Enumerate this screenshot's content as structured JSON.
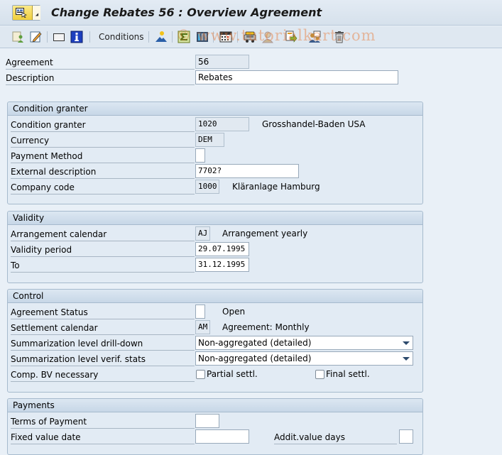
{
  "window": {
    "title": "Change Rebates 56 : Overview Agreement"
  },
  "toolbar": {
    "items": [
      {
        "name": "display-change-icon",
        "type": "icon"
      },
      {
        "name": "edit-icon",
        "type": "icon"
      },
      {
        "name": "blank-screen-icon",
        "type": "icon"
      },
      {
        "name": "info-icon",
        "type": "icon"
      },
      {
        "name": "conditions-button",
        "type": "text",
        "label": "Conditions"
      },
      {
        "name": "partner-icon",
        "type": "icon"
      },
      {
        "name": "sum-icon",
        "type": "icon"
      },
      {
        "name": "columns-icon",
        "type": "icon"
      },
      {
        "name": "calendar-icon",
        "type": "icon"
      },
      {
        "name": "vehicle-icon",
        "type": "icon"
      },
      {
        "name": "user-icon",
        "type": "icon"
      },
      {
        "name": "document-export-icon",
        "type": "icon"
      },
      {
        "name": "people-icon",
        "type": "icon"
      },
      {
        "name": "trash-icon",
        "type": "icon"
      }
    ],
    "conditions_label": "Conditions",
    "watermark": "© www.tutorialkart.com"
  },
  "header": {
    "agreement_label": "Agreement",
    "agreement_value": "56",
    "description_label": "Description",
    "description_value": "Rebates"
  },
  "condition_granter": {
    "title": "Condition granter",
    "granter_label": "Condition granter",
    "granter_value": "1020",
    "granter_name": "Grosshandel-Baden USA",
    "currency_label": "Currency",
    "currency_value": "DEM",
    "payment_method_label": "Payment Method",
    "payment_method_value": "",
    "external_desc_label": "External description",
    "external_desc_value": "7702?",
    "company_code_label": "Company code",
    "company_code_value": "1000",
    "company_name": "Kläranlage Hamburg"
  },
  "validity": {
    "title": "Validity",
    "calendar_label": "Arrangement calendar",
    "calendar_value": "AJ",
    "calendar_text": "Arrangement yearly",
    "period_label": "Validity period",
    "period_from": "29.07.1995",
    "to_label": "To",
    "period_to": "31.12.1995"
  },
  "control": {
    "title": "Control",
    "status_label": "Agreement Status",
    "status_value": "",
    "status_text": "Open",
    "settlement_label": "Settlement calendar",
    "settlement_value": "AM",
    "settlement_text": "Agreement: Monthly",
    "drilldown_label": "Summarization level drill-down",
    "drilldown_value": "Non-aggregated (detailed)",
    "verif_label": "Summarization level verif. stats",
    "verif_value": "Non-aggregated (detailed)",
    "comp_bv_label": "Comp. BV necessary",
    "partial_label": "Partial settl.",
    "partial_checked": false,
    "final_label": "Final settl.",
    "final_checked": false
  },
  "payments": {
    "title": "Payments",
    "terms_label": "Terms of Payment",
    "terms_value": "",
    "fixed_date_label": "Fixed value date",
    "fixed_date_value": "",
    "addit_days_label": "Addit.value days",
    "addit_days_value": ""
  },
  "colors": {
    "background": "#e9f0f7",
    "group_header": "#c7d7e7",
    "menu_button": "#f0cf3c"
  }
}
